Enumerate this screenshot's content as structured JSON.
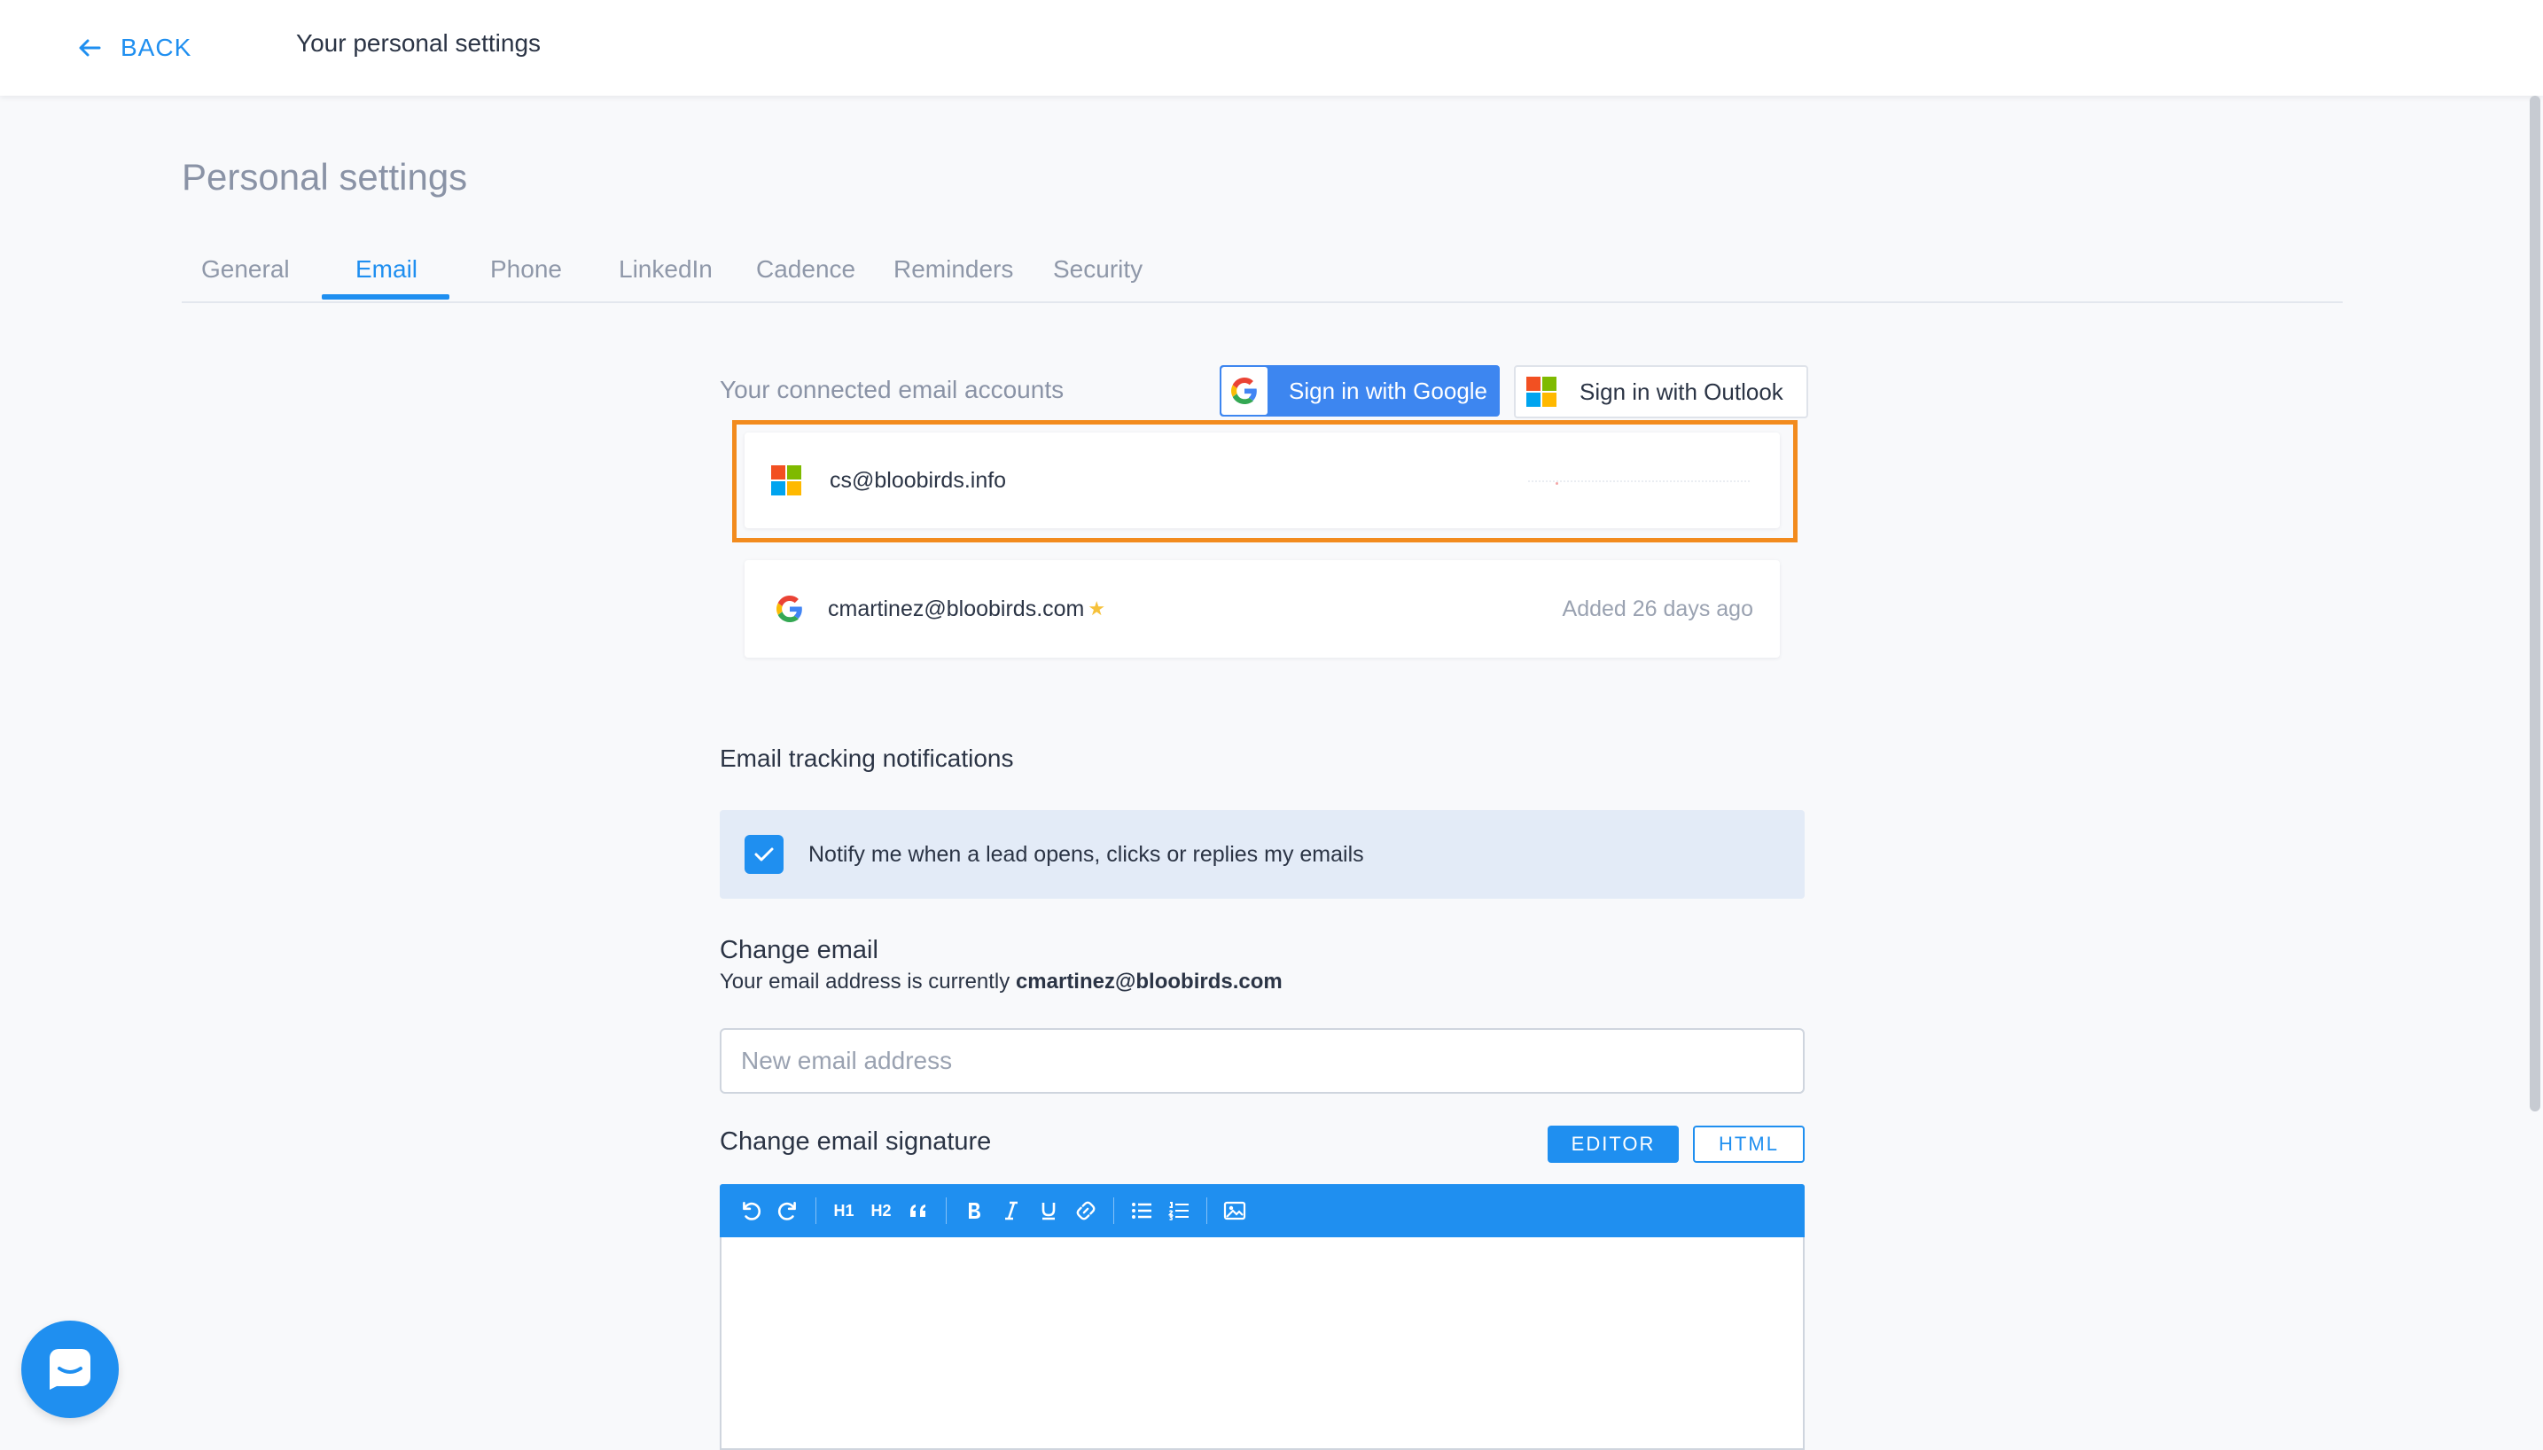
{
  "header": {
    "back_label": "BACK",
    "title": "Your personal settings"
  },
  "page": {
    "title": "Personal settings"
  },
  "tabs": [
    {
      "label": "General",
      "active": false
    },
    {
      "label": "Email",
      "active": true
    },
    {
      "label": "Phone",
      "active": false
    },
    {
      "label": "LinkedIn",
      "active": false
    },
    {
      "label": "Cadence",
      "active": false
    },
    {
      "label": "Reminders",
      "active": false
    },
    {
      "label": "Security",
      "active": false
    }
  ],
  "connected": {
    "label": "Your connected email accounts",
    "google_button": "Sign in with Google",
    "outlook_button": "Sign in with Outlook",
    "accounts": [
      {
        "provider": "microsoft",
        "email": "cs@bloobirds.info",
        "added": ""
      },
      {
        "provider": "google",
        "email": "cmartinez@bloobirds.com",
        "added": "Added 26 days ago",
        "starred": true
      }
    ]
  },
  "tracking": {
    "title": "Email tracking notifications",
    "notify_label": "Notify me when a lead opens, clicks or replies my emails",
    "checked": true
  },
  "change_email": {
    "title": "Change email",
    "current_prefix": "Your email address is currently",
    "current_email": "cmartinez@bloobirds.com",
    "placeholder": "New email address",
    "value": ""
  },
  "signature": {
    "title": "Change email signature",
    "editor_label": "EDITOR",
    "html_label": "HTML",
    "toolbar": {
      "h1": "H1",
      "h2": "H2"
    },
    "content": ""
  },
  "colors": {
    "accent": "#1f8ff0",
    "highlight": "#f28b1e",
    "google_button": "#3d86f0",
    "notify_bg": "#e3ebf7",
    "star": "#f6c13a"
  },
  "icons": {
    "back": "arrow-left-icon",
    "checkbox": "check-icon",
    "chat": "chat-icon"
  }
}
